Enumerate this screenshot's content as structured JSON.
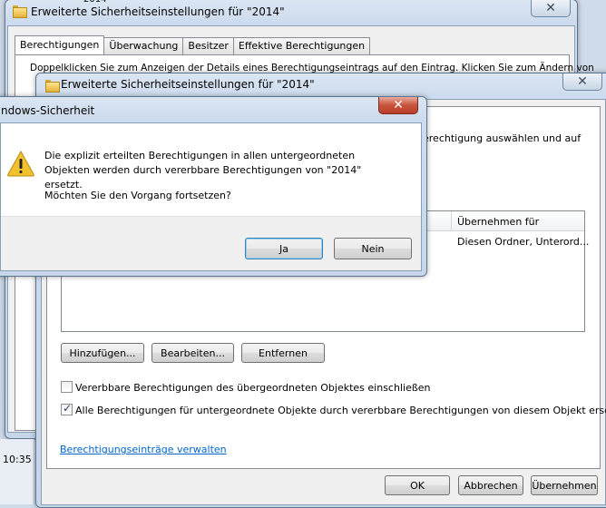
{
  "back_window": {
    "title": "Erweiterte Sicherheitseinstellungen für \"2014\"",
    "tabs": [
      "Berechtigungen",
      "Überwachung",
      "Besitzer",
      "Effektive Berechtigungen"
    ],
    "instruction": "Doppelklicken Sie zum Anzeigen der Details eines Berechtigungseintrags auf den Eintrag. Klicken Sie zum Ändern von",
    "peek_text": "2014",
    "clock": "10:35"
  },
  "main_window": {
    "title": "Erweiterte Sicherheitseinstellungen für \"2014\"",
    "instruction_tail": "erechtigung auswählen und auf",
    "column_header": "Übernehmen für",
    "row_value": "Diesen Ordner, Unterord...",
    "buttons": {
      "add": "Hinzufügen...",
      "edit": "Bearbeiten...",
      "remove": "Entfernen"
    },
    "checkbox_inherit": "Vererbbare Berechtigungen des übergeordneten Objektes einschließen",
    "checkbox_replace": "Alle Berechtigungen für untergeordnete Objekte durch vererbbare Berechtigungen von diesem Objekt ersetzen",
    "checkbox_inherit_checked": false,
    "checkbox_replace_checked": true,
    "manage_link": "Berechtigungseinträge verwalten",
    "ok": "OK",
    "cancel": "Abbrechen",
    "apply": "Übernehmen"
  },
  "dialog": {
    "title": "ndows-Sicherheit",
    "message": "Die explizit erteilten Berechtigungen in allen untergeordneten Objekten werden durch vererbbare Berechtigungen von \"2014\" ersetzt.",
    "question": "Möchten Sie den Vorgang fortsetzen?",
    "yes": "Ja",
    "no": "Nein"
  },
  "colors": {
    "accent": "#3c7fb1",
    "link": "#0066cc",
    "warning": "#f2c12e"
  }
}
